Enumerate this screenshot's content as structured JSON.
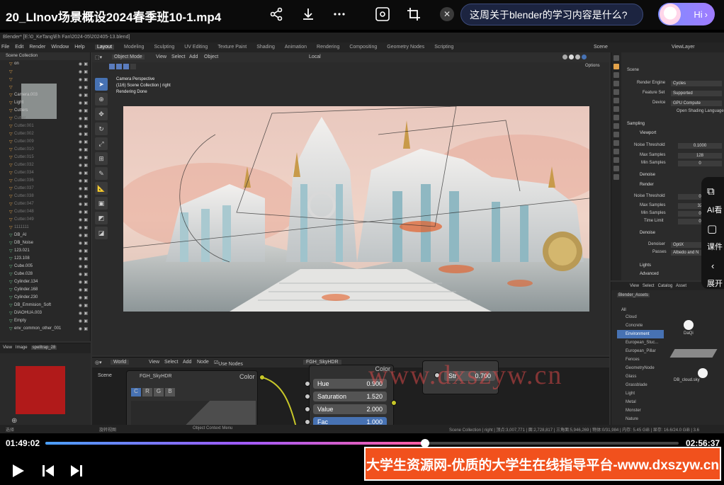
{
  "player": {
    "title": "20_LInov场景概设2024春季班10-1.mp4",
    "ai_question": "这周关于blender的学习内容是什么?",
    "hi_label": "Hi",
    "time_current": "01:49:02",
    "time_total": "02:56:37",
    "progress_fraction": 0.6,
    "icons": [
      "share-icon",
      "download-icon",
      "more-icon",
      "screenshot-icon",
      "crop-icon",
      "close-icon",
      "play-icon",
      "prev-icon",
      "next-icon"
    ],
    "side_items": [
      "AI看",
      "课件",
      "展开"
    ],
    "banner": "大学生资源网-优质的大学生在线指导平台-www.dxszyw.cn",
    "watermark": "www.dxszyw.cn"
  },
  "blender": {
    "window_title": "Blender* [E:\\0_KeTang\\Eh Fan\\2024-05\\202405-13.blend]",
    "menu": [
      "File",
      "Edit",
      "Render",
      "Window",
      "Help"
    ],
    "workspaces": [
      "Layout",
      "Modeling",
      "Sculpting",
      "UV Editing",
      "Texture Paint",
      "Shading",
      "Animation",
      "Rendering",
      "Compositing",
      "Geometry Nodes",
      "Scripting"
    ],
    "scene_label": "Scene",
    "viewlayer_label": "ViewLayer",
    "viewport": {
      "mode": "Object Mode",
      "menu": [
        "View",
        "Select",
        "Add",
        "Object"
      ],
      "transform": "Local",
      "options": "Options",
      "info": [
        "Camera Perspective",
        "(116) Scene Collection | right",
        "Rendering Done"
      ]
    },
    "outliner": {
      "header": "Scene Collection",
      "rows": [
        {
          "name": "on",
          "dim": false
        },
        {
          "name": "",
          "dim": false
        },
        {
          "name": "",
          "dim": false
        },
        {
          "name": "",
          "dim": false
        },
        {
          "name": "Camera.003",
          "dim": false
        },
        {
          "name": "Light",
          "dim": false
        },
        {
          "name": "Cutters",
          "dim": false
        },
        {
          "name": "Cutter",
          "dim": true
        },
        {
          "name": "Cutter.001",
          "dim": true
        },
        {
          "name": "Cutter.002",
          "dim": true
        },
        {
          "name": "Cutter.009",
          "dim": true
        },
        {
          "name": "Cutter.010",
          "dim": true
        },
        {
          "name": "Cutter.015",
          "dim": true
        },
        {
          "name": "Cutter.032",
          "dim": true
        },
        {
          "name": "Cutter.034",
          "dim": true
        },
        {
          "name": "Cutter.036",
          "dim": true
        },
        {
          "name": "Cutter.037",
          "dim": true
        },
        {
          "name": "Cutter.038",
          "dim": true
        },
        {
          "name": "Cutter.047",
          "dim": true
        },
        {
          "name": "Cutter.048",
          "dim": true
        },
        {
          "name": "Cutter.049",
          "dim": true
        },
        {
          "name": "1111111",
          "dim": true
        },
        {
          "name": "DB_AI",
          "dim": false
        },
        {
          "name": "DB_Noise",
          "dim": false
        },
        {
          "name": "123.021",
          "dim": false
        },
        {
          "name": "123.108",
          "dim": false
        },
        {
          "name": "Cube.005",
          "dim": false
        },
        {
          "name": "Cube.028",
          "dim": false
        },
        {
          "name": "Cylinder.134",
          "dim": false
        },
        {
          "name": "Cylinder.168",
          "dim": false
        },
        {
          "name": "Cylinder.230",
          "dim": false
        },
        {
          "name": "DB_Emmision_Soft",
          "dim": false
        },
        {
          "name": "DIAOHUA.003",
          "dim": false
        },
        {
          "name": "Empty",
          "dim": false
        },
        {
          "name": "env_common_other_001",
          "dim": false
        }
      ]
    },
    "image_editor": {
      "menu": [
        "View",
        "Image"
      ],
      "image_name": "spelltrap_28"
    },
    "properties": {
      "scene_label": "Scene",
      "render_engine_label": "Render Engine",
      "render_engine": "Cycles",
      "feature_set_label": "Feature Set",
      "feature_set": "Supported",
      "device_label": "Device",
      "device": "GPU Compute",
      "osl_label": "Open Shading Language",
      "sampling": "Sampling",
      "viewport": "Viewport",
      "noise_threshold_label": "Noise Threshold",
      "noise_threshold": "0.1000",
      "max_samples_label": "Max Samples",
      "max_samples": "128",
      "min_samples_label": "Min Samples",
      "min_samples": "0",
      "denoise": "Denoise",
      "render": "Render",
      "r_noise_threshold": "0",
      "r_max_samples": "32",
      "r_min_samples": "0",
      "time_limit_label": "Time Limit",
      "time_limit": "0",
      "denoise2": "Denoise",
      "denoiser_label": "Denoiser",
      "denoiser": "OptiX",
      "passes_label": "Passes",
      "passes": "Albedo and N",
      "lights": "Lights",
      "advanced": "Advanced"
    },
    "assets": {
      "menu": [
        "View",
        "Select",
        "Catalog",
        "Asset"
      ],
      "library": "Blender_Assets",
      "all": "All",
      "list": [
        "Cloud",
        "Concrete",
        "Environment",
        "European_Stuc...",
        "European_Pillar",
        "Fences",
        "GeometryNode",
        "Glass",
        "Grassblade",
        "Light",
        "Metal",
        "Monster",
        "Nature"
      ],
      "selected": "Environment",
      "items": [
        "DaQi",
        "DB_cloud.sky"
      ]
    },
    "node_editor": {
      "world_label": "World",
      "menu": [
        "View",
        "Select",
        "Add",
        "Node"
      ],
      "use_nodes": "Use Nodes",
      "node_group": "FGH_SkyHDR",
      "scene_label": "Scene",
      "node_name": "FGH_SkyHDR",
      "color_label": "Color",
      "color_label2": "Color",
      "rgb_buttons": [
        "C",
        "R",
        "G",
        "B"
      ],
      "fields": [
        {
          "label": "Hue",
          "value": "0.900"
        },
        {
          "label": "Saturation",
          "value": "1.520"
        },
        {
          "label": "Value",
          "value": "2.000"
        },
        {
          "label": "Fac",
          "value": "1.000"
        }
      ],
      "strength_label": "Str",
      "strength_value": "0.700"
    },
    "status": {
      "left": "选择",
      "mid": "旋转视图",
      "ctx": "Object Context Menu",
      "right": "Scene Collection | right | 顶点:3,007,771 | 面:2,728,817 | 三角面:5,946,269 | 物体:0/31,984 | 内存: 5.45 GiB | 显存: 16.6/24.0 GiB | 3.6"
    },
    "colors": {
      "accent": "#4772b3",
      "orange": "#e3a24a",
      "socket_yellow": "#c7c729"
    }
  }
}
